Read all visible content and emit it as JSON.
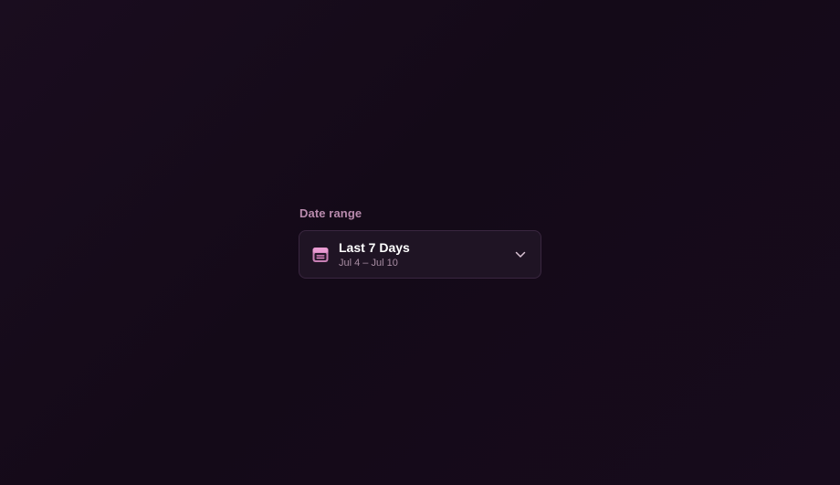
{
  "date_range": {
    "label": "Date range",
    "selected_title": "Last 7 Days",
    "selected_range": "Jul 4 – Jul 10",
    "icon": "calendar-icon",
    "chevron_icon": "chevron-down-icon"
  },
  "colors": {
    "background": "#160b1b",
    "label": "#b88aad",
    "accent_icon": "#e58cc9",
    "card_bg": "#1f1424",
    "card_border": "#3a2740"
  }
}
